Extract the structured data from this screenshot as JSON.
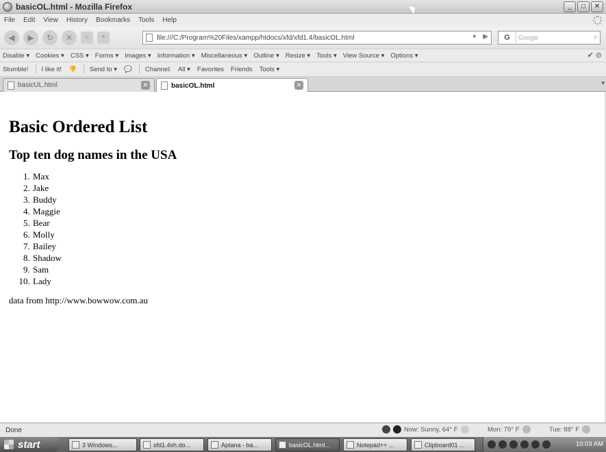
{
  "window": {
    "title": "basicOL.html - Mozilla Firefox",
    "controls": [
      "_",
      "□",
      "✕"
    ]
  },
  "menu": [
    "File",
    "Edit",
    "View",
    "History",
    "Bookmarks",
    "Tools",
    "Help"
  ],
  "nav": {
    "url": "file:///C:/Program%20Files/xampp/htdocs/xfd/xfd1.4/basicOL.html",
    "search_engine": "G",
    "search_placeholder": "Google"
  },
  "devtoolbar": [
    "Disable ▾",
    "Cookies ▾",
    "CSS ▾",
    "Forms ▾",
    "Images ▾",
    "Information ▾",
    "Miscellaneous ▾",
    "Outline ▾",
    "Resize ▾",
    "Tools ▾",
    "View Source ▾",
    "Options ▾"
  ],
  "stumbletoolbar": {
    "stumble": "Stumble!",
    "like": "I like it!",
    "send": "Send to ▾",
    "channel": "Channel:",
    "all": "All ▾",
    "favorites": "Favorites",
    "friends": "Friends",
    "tools": "Tools ▾"
  },
  "tabs": [
    {
      "label": "basicUL.html",
      "active": false
    },
    {
      "label": "basicOL.html",
      "active": true
    }
  ],
  "page": {
    "heading": "Basic Ordered List",
    "subheading": "Top ten dog names in the USA",
    "items": [
      "Max",
      "Jake",
      "Buddy",
      "Maggie",
      "Bear",
      "Molly",
      "Bailey",
      "Shadow",
      "Sam",
      "Lady"
    ],
    "source": "data from http://www.bowwow.com.au"
  },
  "status": {
    "text": "Done",
    "weather_now": "Now: Sunny, 64° F",
    "weather_mon": "Mon: 79° F",
    "weather_tue": "Tue: 88° F"
  },
  "taskbar": {
    "start": "start",
    "items": [
      {
        "label": "3 Windows...",
        "active": false
      },
      {
        "label": "xfd1.4sh.do...",
        "active": false
      },
      {
        "label": "Aptana - ba...",
        "active": false
      },
      {
        "label": "basicOL.html...",
        "active": true
      },
      {
        "label": "Notepad++ ...",
        "active": false
      },
      {
        "label": "Clipboard01 ...",
        "active": false
      }
    ],
    "clock": "10:03 AM"
  }
}
